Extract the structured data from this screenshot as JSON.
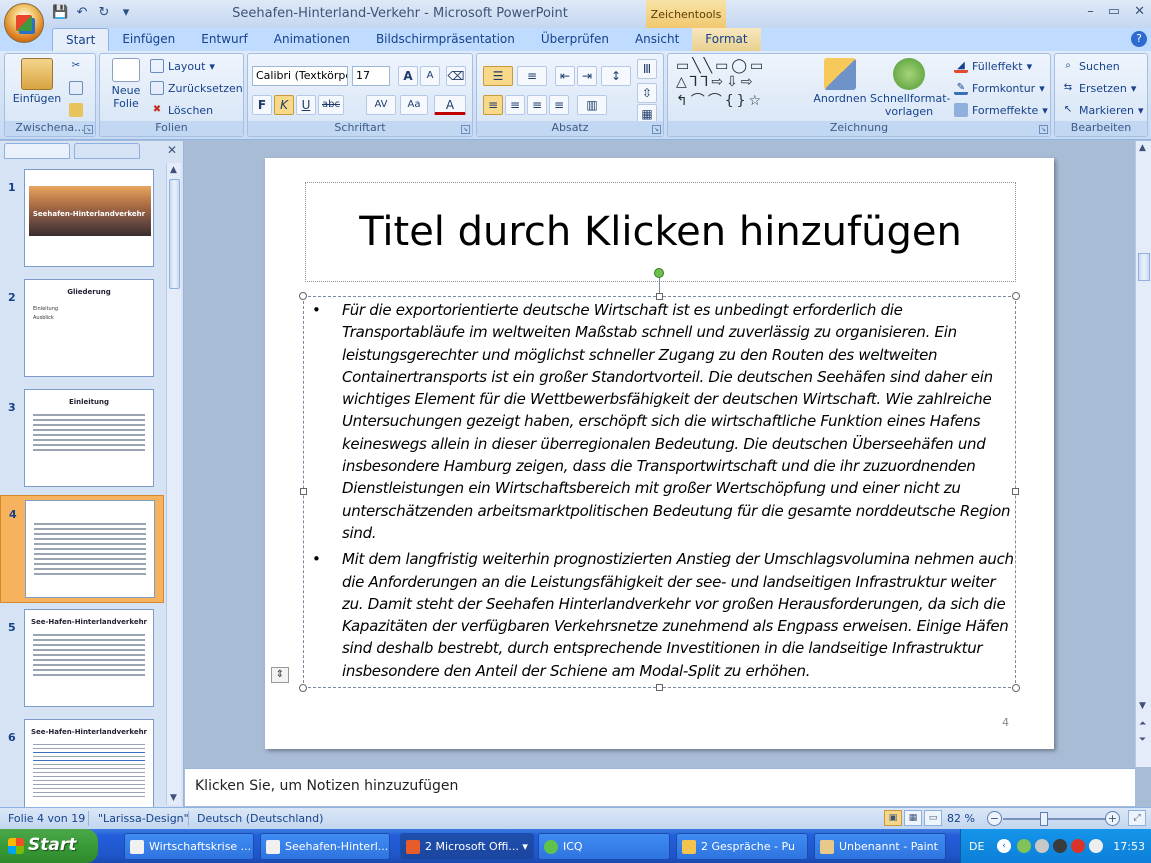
{
  "window": {
    "title": "Seehafen-Hinterland-Verkehr - Microsoft PowerPoint",
    "context_tab": "Zeichentools",
    "controls": [
      "–",
      "▭",
      "✕"
    ]
  },
  "tabs": [
    "Start",
    "Einfügen",
    "Entwurf",
    "Animationen",
    "Bildschirmpräsentation",
    "Überprüfen",
    "Ansicht",
    "Format"
  ],
  "ribbon": {
    "clipboard": {
      "label": "Zwischena...",
      "paste": "Einfügen"
    },
    "slides": {
      "label": "Folien",
      "new_slide": "Neue",
      "new_slide2": "Folie",
      "layout": "Layout",
      "reset": "Zurücksetzen",
      "delete": "Löschen"
    },
    "font": {
      "label": "Schriftart",
      "font_name": "Calibri (Textkörpe",
      "font_size": "17",
      "bold": "F",
      "italic": "K",
      "underline": "U",
      "strike": "abc",
      "spacing": "AV",
      "case": "Aa",
      "color": "A",
      "grow": "A",
      "shrink": "A"
    },
    "paragraph": {
      "label": "Absatz"
    },
    "drawing": {
      "label": "Zeichnung",
      "arrange": "Anordnen",
      "styles": "Schnellformat-",
      "styles2": "vorlagen",
      "fill": "Fülleffekt",
      "outline": "Formkontur",
      "effects": "Formeffekte"
    },
    "editing": {
      "label": "Bearbeiten",
      "find": "Suchen",
      "replace": "Ersetzen",
      "select": "Markieren"
    }
  },
  "thumbnails": [
    {
      "num": "1",
      "title": "Seehafen-Hinterlandverkehr",
      "kind": "image"
    },
    {
      "num": "2",
      "title": "Gliederung",
      "kind": "outline",
      "bullets": [
        "Einleitung",
        "Ausblick"
      ]
    },
    {
      "num": "3",
      "title": "Einleitung",
      "kind": "text"
    },
    {
      "num": "4",
      "title": "",
      "kind": "text",
      "selected": true
    },
    {
      "num": "5",
      "title": "See-Hafen-Hinterlandverkehr",
      "kind": "text"
    },
    {
      "num": "6",
      "title": "See-Hafen-Hinterlandverkehr",
      "kind": "text"
    }
  ],
  "slide": {
    "title": "Titel durch Klicken hinzufügen",
    "paragraphs": [
      "Für die exportorientierte deutsche Wirtschaft ist es unbedingt erforderlich die Transportabläufe im weltweiten Maßstab schnell und zuverlässig zu organisieren. Ein leistungsgerechter und möglichst schneller Zugang zu den Routen des weltweiten Containertransports ist ein großer Standortvorteil. Die deutschen Seehäfen sind daher ein wichtiges Element für die Wettbewerbsfähigkeit der deutschen Wirtschaft. Wie zahlreiche Untersuchungen gezeigt haben, erschöpft sich die wirtschaftliche Funktion eines Hafens keineswegs allein in dieser überregionalen Bedeutung. Die deutschen Überseehäfen und insbesondere Hamburg zeigen, dass die Transportwirtschaft und die ihr zuzuordnenden Dienstleistungen ein Wirtschaftsbereich mit großer Wertschöpfung und einer nicht zu unterschätzenden arbeitsmarktpolitischen Bedeutung für die gesamte norddeutsche Region sind.",
      "Mit dem langfristig weiterhin prognostizierten Anstieg der Umschlagsvolumina nehmen auch die Anforderungen an die Leistungsfähigkeit der see- und landseitigen Infrastruktur weiter zu. Damit steht der Seehafen Hinterlandverkehr vor großen Herausforderungen, da sich die Kapazitäten der verfügbaren Verkehrsnetze zunehmend als Engpass erweisen. Einige Häfen sind deshalb bestrebt, durch entsprechende Investitionen in die landseitige Infrastruktur insbesondere den Anteil der Schiene am Modal-Split zu erhöhen."
    ],
    "page_number": "4"
  },
  "notes": {
    "placeholder": "Klicken Sie, um Notizen hinzuzufügen"
  },
  "status": {
    "slide_of": "Folie 4 von 19",
    "design": "\"Larissa-Design\"",
    "language": "Deutsch (Deutschland)",
    "zoom": "82 %"
  },
  "taskbar": {
    "start": "Start",
    "tasks": [
      "Wirtschaftskrise ...",
      "Seehafen-Hinterl...",
      "2 Microsoft Offi...",
      "ICQ",
      "2 Gespräche - Pu",
      "Unbenannt - Paint"
    ],
    "lang": "DE",
    "clock": "17:53"
  }
}
